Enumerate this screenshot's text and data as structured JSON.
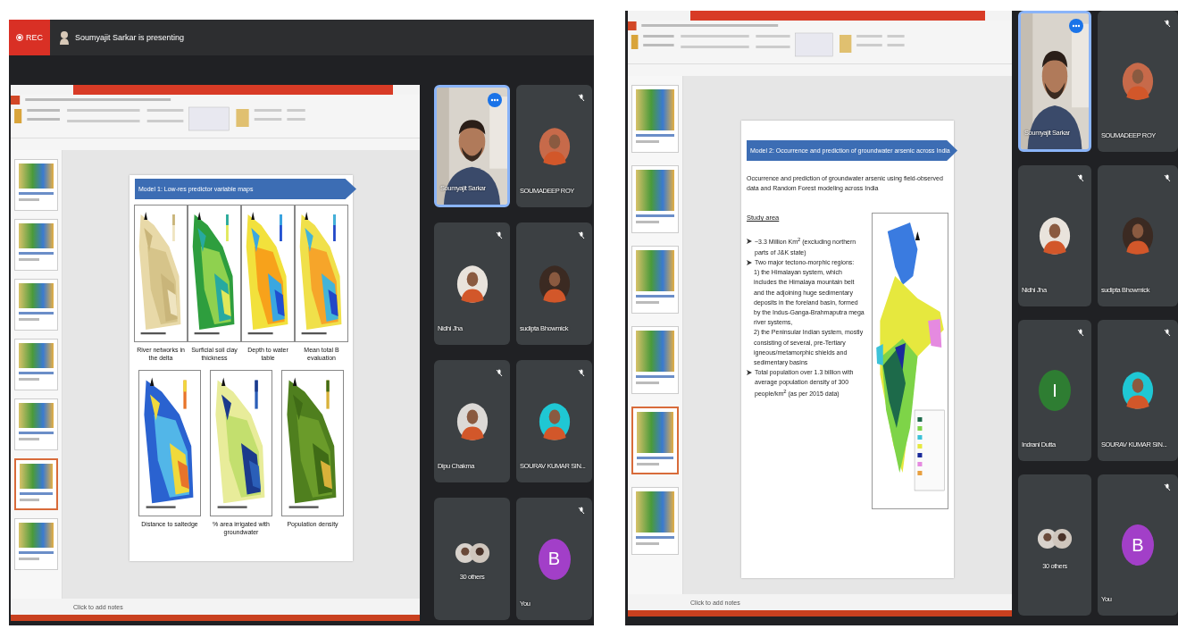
{
  "screens": [
    {
      "recording_badge": "REC",
      "presenter_banner": "Soumyajit Sarkar is presenting",
      "thumbnails": [
        {
          "selected": false
        },
        {
          "selected": false
        },
        {
          "selected": false
        },
        {
          "selected": false
        },
        {
          "selected": false
        },
        {
          "selected": true
        },
        {
          "selected": false
        }
      ],
      "slide": {
        "kind": "map-grid",
        "title": "Model 1: Low-res predictor variable maps",
        "figures": [
          {
            "caption": "River networks in the delta"
          },
          {
            "caption": "Surficial soil clay thickness"
          },
          {
            "caption": "Depth to water table"
          },
          {
            "caption": "Mean total B evaluation"
          },
          {
            "caption": "Distance to saltedge"
          },
          {
            "caption": "% area irrigated with groundwater"
          },
          {
            "caption": "Population density"
          }
        ]
      },
      "notes_placeholder": "Click to add notes",
      "participants": [
        {
          "name": "Soumyajit Sarkar",
          "kind": "video",
          "highlighted": true,
          "muted": false
        },
        {
          "name": "SOUMADEEP ROY",
          "highlighted": false,
          "muted": true
        },
        {
          "name": "Nidhi Jha",
          "highlighted": false,
          "muted": true
        },
        {
          "name": "sudipta Bhowmick",
          "highlighted": false,
          "muted": true
        },
        {
          "name": "Dipu Chakma",
          "highlighted": false,
          "muted": true
        },
        {
          "name": "SOURAV KUMAR SIN...",
          "highlighted": false,
          "muted": true
        },
        {
          "name": "30 others",
          "kind": "group",
          "highlighted": false,
          "muted": false
        },
        {
          "name": "You",
          "kind": "letter",
          "letter": "B",
          "color": "#a23fc8",
          "highlighted": false,
          "muted": true
        }
      ]
    },
    {
      "thumbnails": [
        {
          "selected": false
        },
        {
          "selected": false
        },
        {
          "selected": false
        },
        {
          "selected": false
        },
        {
          "selected": true
        },
        {
          "selected": false
        }
      ],
      "slide": {
        "kind": "study-area",
        "title": "Model 2: Occurrence and prediction of groundwater arsenic across India",
        "paragraph": "Occurrence and prediction of groundwater arsenic using field-observed data and Random Forest modeling across India",
        "subheading": "Study area",
        "bullets": [
          {
            "kind": "bullet",
            "text": "~3.3 Million Km$^{2}$ (excluding northern parts of J&K state)"
          },
          {
            "kind": "bullet",
            "text": "Two major tectono-morphic regions:"
          },
          {
            "kind": "sub",
            "text": "1) the Himalayan system, which includes the Himalaya mountain belt and the adjoining huge sedimentary deposits in the foreland basin, formed by the Indus-Ganga-Brahmaputra mega river systems,"
          },
          {
            "kind": "sub",
            "text": "2) the Peninsular Indian system, mostly consisting of several, pre-Tertiary igneous/metamorphic shields and sedimentary basins"
          },
          {
            "kind": "bullet",
            "text": "Total population over 1.3 billion with average population density of 300 people/km$^{2}$ (as per 2015 data)"
          }
        ]
      },
      "notes_placeholder": "Click to add notes",
      "participants": [
        {
          "name": "Soumyajit Sarkar",
          "kind": "video",
          "highlighted": true,
          "muted": false
        },
        {
          "name": "SOUMADEEP ROY",
          "highlighted": false,
          "muted": true
        },
        {
          "name": "Nidhi Jha",
          "highlighted": false,
          "muted": true
        },
        {
          "name": "sudipta Bhowmick",
          "highlighted": false,
          "muted": true
        },
        {
          "name": "Indrani Dutta",
          "kind": "letter",
          "letter": "I",
          "color": "#2e7d32",
          "highlighted": false,
          "muted": true
        },
        {
          "name": "SOURAV KUMAR SIN...",
          "highlighted": false,
          "muted": true
        },
        {
          "name": "30 others",
          "kind": "group",
          "highlighted": false,
          "muted": false
        },
        {
          "name": "You",
          "kind": "letter",
          "letter": "B",
          "color": "#a23fc8",
          "highlighted": false,
          "muted": true
        }
      ]
    }
  ]
}
